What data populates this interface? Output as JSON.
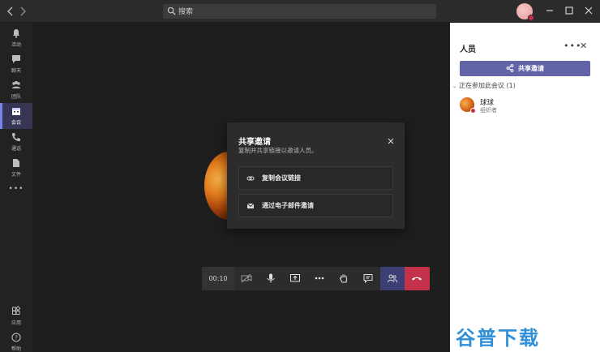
{
  "topbar": {
    "back_icon": "chevron-left-icon",
    "forward_icon": "chevron-right-icon",
    "search_placeholder": "搜索",
    "window_buttons": [
      "minimize-icon",
      "maximize-icon",
      "close-icon"
    ]
  },
  "rail": {
    "items": [
      {
        "label": "活动",
        "icon": "bell-icon",
        "active": false
      },
      {
        "label": "聊天",
        "icon": "chat-icon",
        "active": false
      },
      {
        "label": "团队",
        "icon": "teams-icon",
        "active": false
      },
      {
        "label": "会议",
        "icon": "calendar-icon",
        "active": true
      },
      {
        "label": "通话",
        "icon": "phone-icon",
        "active": false
      },
      {
        "label": "文件",
        "icon": "file-icon",
        "active": false
      }
    ],
    "more": "•••",
    "bottom": [
      {
        "label": "应用",
        "icon": "apps-icon"
      },
      {
        "label": "帮助",
        "icon": "help-icon"
      }
    ]
  },
  "modal": {
    "title": "共享邀请",
    "subtitle": "复制并共享链接以邀请人员。",
    "options": [
      {
        "label": "复制会议链接",
        "icon": "link-icon"
      },
      {
        "label": "通过电子邮件邀请",
        "icon": "mail-icon"
      }
    ]
  },
  "controls": {
    "timer": "00:10",
    "buttons": [
      "camera-off-icon",
      "mic-icon",
      "share-screen-icon",
      "more-icon",
      "raise-hand-icon",
      "chat-icon",
      "people-icon",
      "hang-up-icon"
    ]
  },
  "panel": {
    "title": "人员",
    "more": "•••",
    "close": "✕",
    "share_button": "共享邀请",
    "section_label": "正在参加此会议 (1)",
    "members": [
      {
        "name": "球球",
        "role": "组织者"
      }
    ]
  },
  "watermark": "谷普下载",
  "colors": {
    "accent": "#6264a7",
    "hangup": "#c4314b",
    "active_rail": "#363654"
  }
}
